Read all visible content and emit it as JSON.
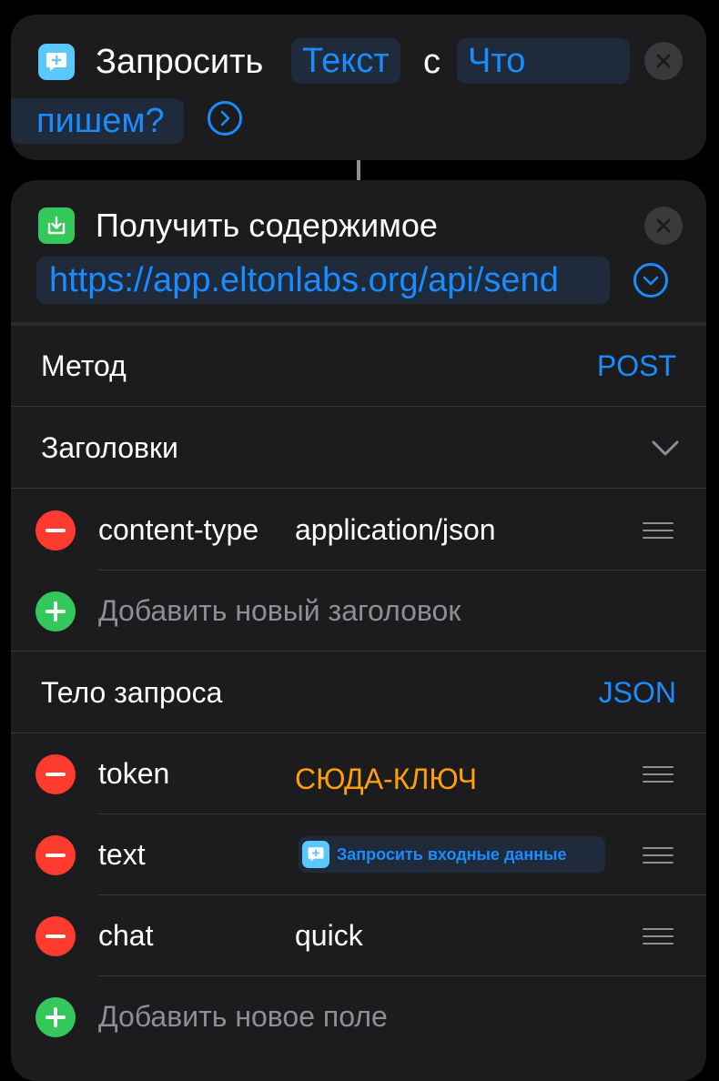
{
  "ask_action": {
    "title": "Запросить",
    "type_value": "Текст",
    "connector": "с",
    "prompt_line1": "Что",
    "prompt_line2": "пишем?"
  },
  "get_contents_action": {
    "title": "Получить содержимое",
    "url": "https://app.eltonlabs.org/api/send",
    "method_label": "Метод",
    "method_value": "POST",
    "headers_label": "Заголовки",
    "headers": [
      {
        "key": "content-type",
        "value": "application/json"
      }
    ],
    "add_header_label": "Добавить новый заголовок",
    "body_label": "Тело запроса",
    "body_type": "JSON",
    "fields": [
      {
        "key": "token",
        "value": "СЮДА-КЛЮЧ"
      },
      {
        "key": "text",
        "value": "Запросить входные данные"
      },
      {
        "key": "chat",
        "value": "quick"
      }
    ],
    "add_field_label": "Добавить новое поле"
  },
  "colors": {
    "accent": "#1a8cff",
    "orange": "#ff9f0a",
    "remove": "#ff3b30",
    "add": "#34c759",
    "card": "#1c1c1e"
  },
  "icons": {
    "ask_for_input": "speech-bubble-plus-icon",
    "get_contents": "download-tray-icon",
    "close": "close-icon",
    "expand_arrow": "chevron-right-circle-icon",
    "url_expand": "chevron-down-circle-icon",
    "headers_toggle": "chevron-down-icon",
    "remove": "minus-circle-icon",
    "add": "plus-circle-icon",
    "reorder": "drag-handle-icon"
  }
}
